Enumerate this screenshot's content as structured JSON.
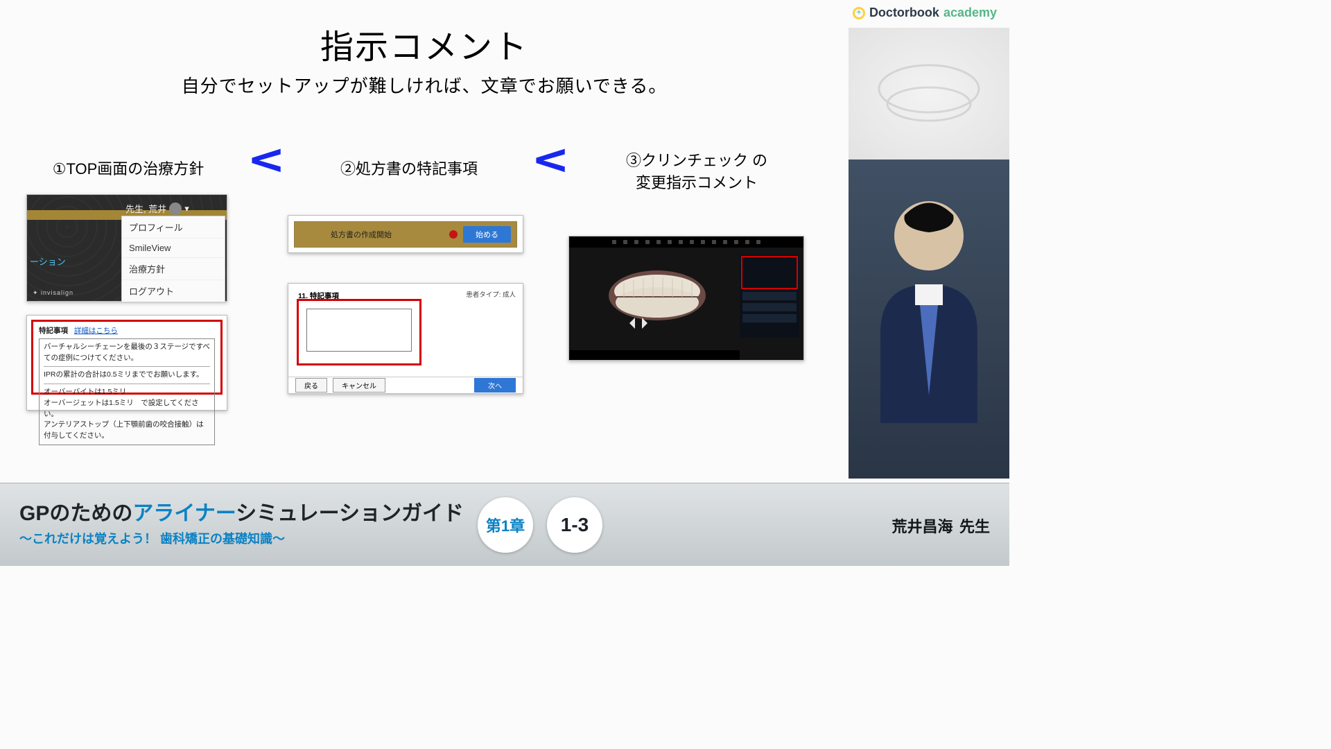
{
  "brand": {
    "word1": "Doctorbook",
    "word2": "academy"
  },
  "slide": {
    "title": "指示コメント",
    "subtitle": "自分でセットアップが難しければ、文章でお願いできる。"
  },
  "headings": {
    "h1": "①TOP画面の治療方針",
    "h2": "②処方書の特記事項",
    "h3": "③クリンチェック の\n変更指示コメント"
  },
  "c1a": {
    "user_label": "先生, 荒井",
    "menu": [
      "プロフィール",
      "SmileView",
      "治療方針",
      "ログアウト"
    ],
    "ribbon": "ーション",
    "corner": "✦ invisalign"
  },
  "c1b": {
    "title": "特記事項",
    "link": "詳細はこちら",
    "line1": "バーチャルシーチェーンを最後の３ステージですべての症例につけてください。",
    "line2": "IPRの累計の合計は0.5ミリまででお願いします。",
    "line3": "オーバーバイトは1.5ミリ",
    "line4": "オーバージェットは1.5ミリ　で設定してください。",
    "line5": "アンテリアストップ（上下顎前歯の咬合接触）は付与してください。"
  },
  "c2a": {
    "text": "処方書の作成開始",
    "button": "始める"
  },
  "c2b": {
    "title": "11. 特記事項",
    "meta": "患者タイプ: 成人",
    "back": "戻る",
    "cancel": "キャンセル",
    "next": "次へ"
  },
  "footer": {
    "title_pre": "GPのための",
    "title_em": "アライナー",
    "title_post": "シミュレーションガイド",
    "subtitle": "〜これだけは覚えよう！ 歯科矯正の基礎知識〜",
    "chapter": "第1章",
    "number": "1-3",
    "speaker_name": "荒井昌海",
    "speaker_suffix": "先生"
  }
}
